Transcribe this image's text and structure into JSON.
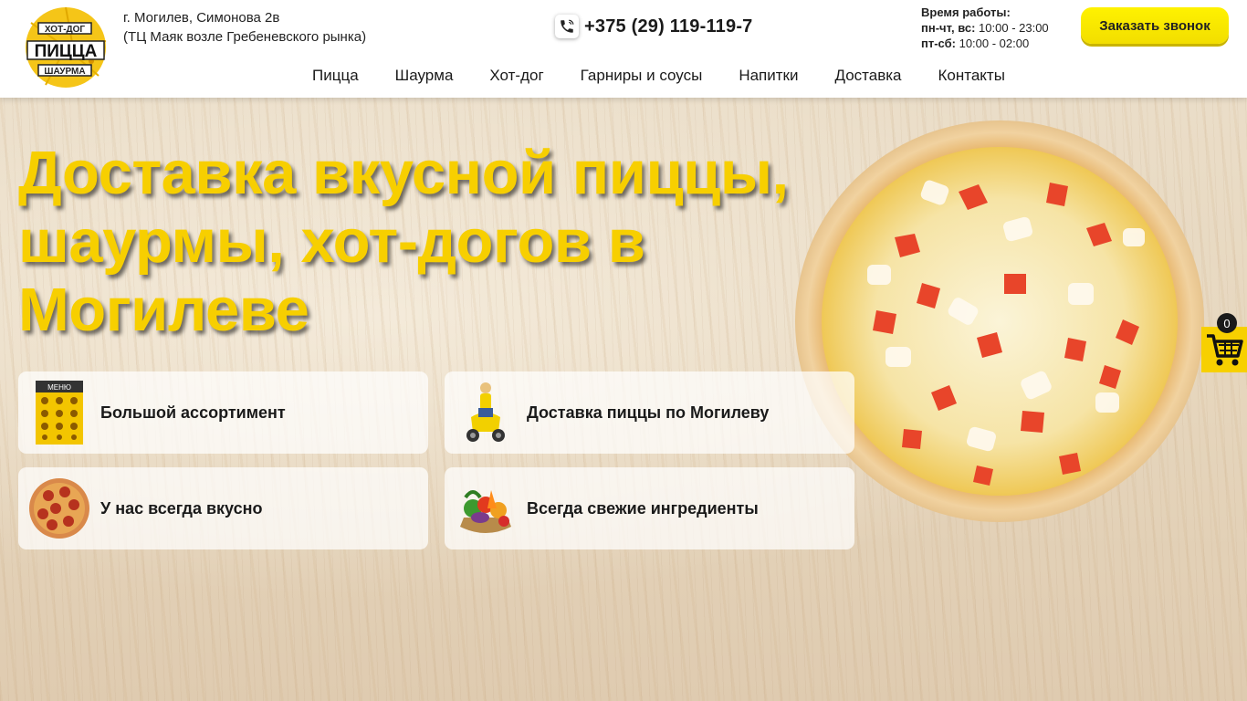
{
  "header": {
    "logo_text": {
      "top": "ХОТ-ДОГ",
      "middle": "ПИЦЦА",
      "bottom": "ШАУРМА"
    },
    "address_line1": "г. Могилев, Симонова 2в",
    "address_line2": "(ТЦ Маяк возле Гребеневского рынка)",
    "phone": "+375 (29) 119-119-7",
    "hours_title": "Время работы:",
    "hours_1_days": "пн-чт, вс:",
    "hours_1_time": "10:00 - 23:00",
    "hours_2_days": "пт-сб:",
    "hours_2_time": "10:00 - 02:00",
    "callback_label": "Заказать звонок"
  },
  "nav": {
    "items": [
      {
        "label": "Пицца"
      },
      {
        "label": "Шаурма"
      },
      {
        "label": "Хот-дог"
      },
      {
        "label": "Гарниры и соусы"
      },
      {
        "label": "Напитки"
      },
      {
        "label": "Доставка"
      },
      {
        "label": "Контакты"
      }
    ]
  },
  "hero": {
    "title": "Доставка вкусной пиццы, шаурмы, хот-догов в Могилеве"
  },
  "features": [
    {
      "label": "Большой ассортимент",
      "icon": "menu-board-icon",
      "thumb_text": "МЕНЮ"
    },
    {
      "label": "Доставка пиццы по Могилеву",
      "icon": "delivery-scooter-icon"
    },
    {
      "label": "У нас всегда вкусно",
      "icon": "pepperoni-pizza-icon"
    },
    {
      "label": "Всегда свежие ингредиенты",
      "icon": "vegetables-icon"
    }
  ],
  "cart": {
    "count": "0",
    "icon": "cart-icon"
  },
  "colors": {
    "accent": "#f7cf00",
    "button": "#fff200",
    "text": "#1a1a1a"
  }
}
